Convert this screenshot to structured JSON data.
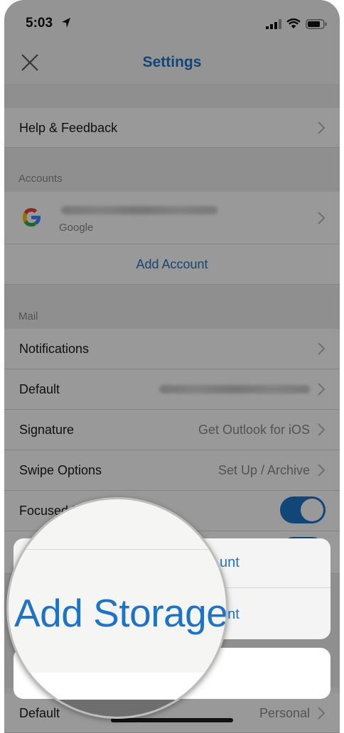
{
  "status_bar": {
    "time": "5:03"
  },
  "nav": {
    "title": "Settings",
    "close_icon": "close-icon"
  },
  "rows": {
    "help_feedback": "Help & Feedback"
  },
  "accounts": {
    "header": "Accounts",
    "google_account_provider": "Google",
    "add_account": "Add Account"
  },
  "mail": {
    "header": "Mail",
    "notifications": "Notifications",
    "default_label": "Default",
    "signature_label": "Signature",
    "signature_value": "Get Outlook for iOS",
    "swipe_label": "Swipe Options",
    "swipe_value": "Set Up / Archive",
    "focused_label": "Focused I"
  },
  "calendar_default": {
    "label": "Default",
    "value": "Personal"
  },
  "action_sheet": {
    "option1_tail": "unt",
    "option2_tail": "unt"
  },
  "magnifier": {
    "text": "Add Storage"
  },
  "colors": {
    "accent": "#1e73c8",
    "toggle_on": "#1e73c8",
    "google_blue": "#4285F4",
    "google_red": "#EA4335",
    "google_yellow": "#FBBC05",
    "google_green": "#34A853"
  }
}
